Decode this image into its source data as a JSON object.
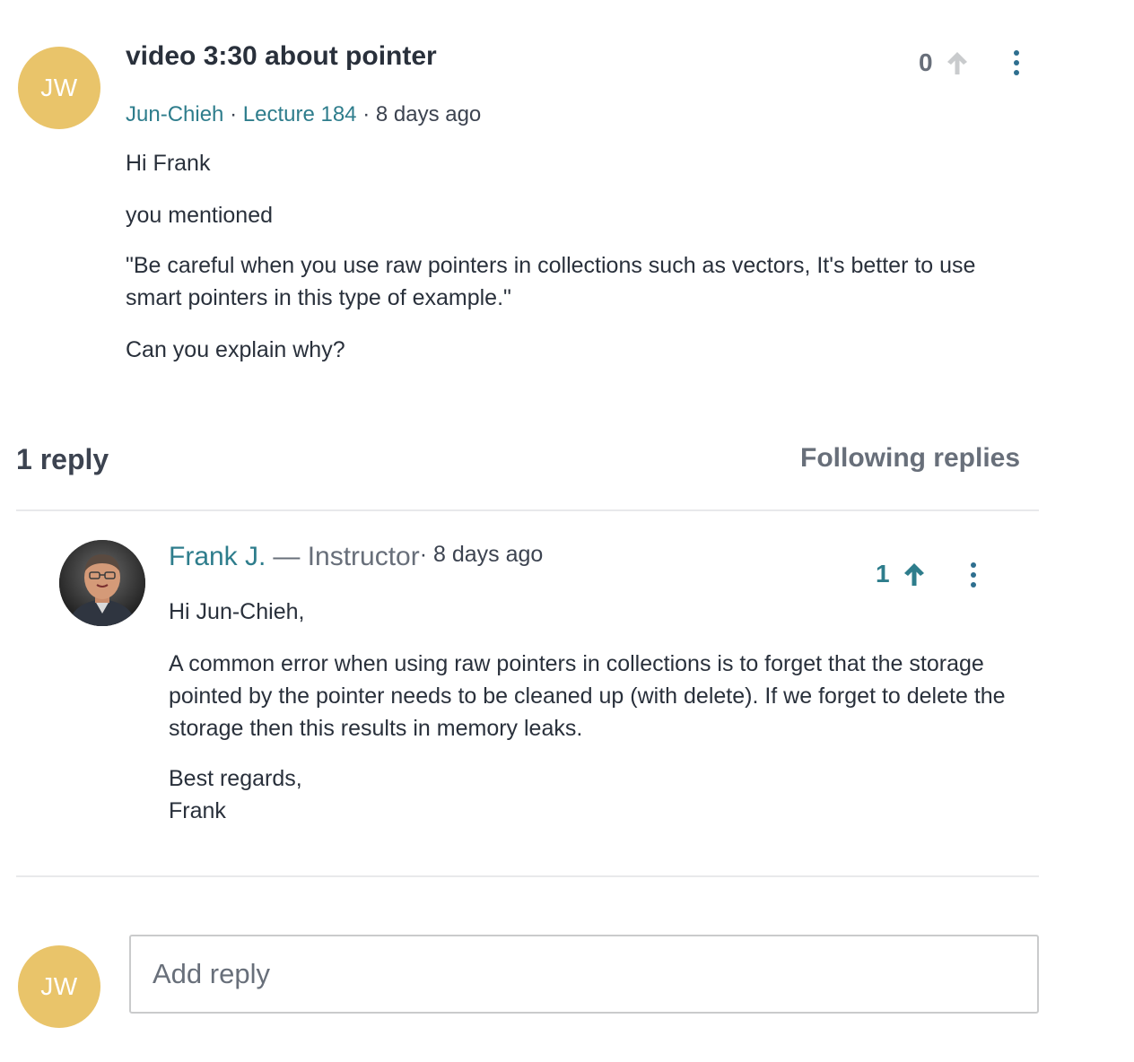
{
  "question": {
    "avatar_initials": "JW",
    "title": "video 3:30 about pointer",
    "author": "Jun-Chieh",
    "lecture": "Lecture 184",
    "time": "8 days ago",
    "vote_count": "0",
    "body": [
      "Hi Frank",
      "you mentioned",
      "\"Be careful when you use raw pointers in collections such as vectors, It's better to use smart pointers in this type of example.\"",
      "Can you explain why?"
    ]
  },
  "replies_header": {
    "count_label": "1 reply",
    "following_label": "Following replies"
  },
  "reply": {
    "author": "Frank J.",
    "role": "— Instructor",
    "time": "· 8 days ago",
    "vote_count": "1",
    "body": [
      "Hi Jun-Chieh,",
      "A common error when using raw pointers in collections is to forget that the storage pointed by the pointer needs to be cleaned up (with delete). If we forget to delete the storage then this results in memory leaks.",
      "Best regards,",
      "Frank"
    ]
  },
  "composer": {
    "avatar_initials": "JW",
    "placeholder": "Add reply"
  },
  "colors": {
    "accent": "#2e7d8c",
    "avatar_bg": "#e9c46a"
  }
}
